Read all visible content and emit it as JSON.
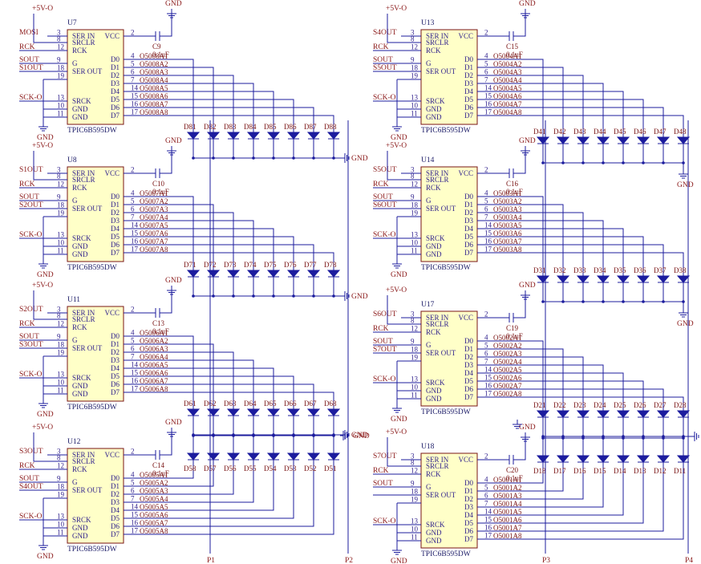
{
  "net_labels": {
    "supply": "+5V-O",
    "ground": "GND",
    "clock": "SCK-O",
    "cap_value": "0.1uF"
  },
  "chip": {
    "part": "TPIC6B595DW",
    "left_pins": [
      "SER IN",
      "SRCLR",
      "RCK",
      "G",
      "SER OUT",
      "",
      "SRCK",
      "GND",
      "GND"
    ],
    "left_nums": [
      "3",
      "8",
      "12",
      "9",
      "18",
      "19",
      "13",
      "10",
      "11"
    ],
    "right_pins": [
      "VCC",
      "D0",
      "D1",
      "D2",
      "D3",
      "D4",
      "D5",
      "D6",
      "D7"
    ],
    "right_nums": [
      "2",
      "4",
      "5",
      "6",
      "7",
      "14",
      "15",
      "16",
      "17"
    ]
  },
  "ports": [
    "P1",
    "P2",
    "P3",
    "P4"
  ],
  "blocks": [
    {
      "id": "U7",
      "cap": "C9",
      "ser_in": "MOSI",
      "sout_a": "SOUT",
      "sout_b": "S1OUT",
      "outputs": [
        "O5008A1",
        "O5008A2",
        "O5008A3",
        "O5008A4",
        "O5008A5",
        "O5008A6",
        "O5008A7",
        "O5008A8"
      ],
      "diodes": [
        "D81",
        "D82",
        "D83",
        "D84",
        "D85",
        "D86",
        "D87",
        "D88"
      ],
      "diodes2": []
    },
    {
      "id": "U8",
      "cap": "C10",
      "ser_in": "S1OUT",
      "sout_a": "SOUT",
      "sout_b": "S2OUT",
      "outputs": [
        "O5007A1",
        "O5007A2",
        "O5007A3",
        "O5007A4",
        "O5007A5",
        "O5007A6",
        "O5007A7",
        "O5007A8"
      ],
      "diodes": [
        "D71",
        "D72",
        "D73",
        "D74",
        "D75",
        "D76",
        "D77",
        "D78"
      ],
      "diodes2": []
    },
    {
      "id": "U11",
      "cap": "C13",
      "ser_in": "S2OUT",
      "sout_a": "SOUT",
      "sout_b": "S3OUT",
      "outputs": [
        "O5006A1",
        "O5006A2",
        "O5006A3",
        "O5006A4",
        "O5006A5",
        "O5006A6",
        "O5006A7",
        "O5006A8"
      ],
      "diodes": [
        "D61",
        "D62",
        "D63",
        "D64",
        "D65",
        "D66",
        "D67",
        "D68"
      ],
      "diodes2": []
    },
    {
      "id": "U12",
      "cap": "C14",
      "ser_in": "S3OUT",
      "sout_a": "SOUT",
      "sout_b": "S4OUT",
      "outputs": [
        "O5005A1",
        "O5005A2",
        "O5005A3",
        "O5005A4",
        "O5005A5",
        "O5005A6",
        "O5005A7",
        "O5005A8"
      ],
      "diodes": [],
      "diodes2": [
        "D58",
        "D57",
        "D56",
        "D55",
        "D54",
        "D53",
        "D52",
        "D51"
      ]
    },
    {
      "id": "U13",
      "cap": "C15",
      "ser_in": "S4OUT",
      "sout_a": "SOUT",
      "sout_b": "S5OUT",
      "outputs": [
        "O5004A1",
        "O5004A2",
        "O5004A3",
        "O5004A4",
        "O5004A5",
        "O5004A6",
        "O5004A7",
        "O5004A8"
      ],
      "diodes": [
        "D41",
        "D42",
        "D43",
        "D44",
        "D45",
        "D46",
        "D47",
        "D48"
      ],
      "diodes2": []
    },
    {
      "id": "U14",
      "cap": "C16",
      "ser_in": "S5OUT",
      "sout_a": "SOUT",
      "sout_b": "S6OUT",
      "outputs": [
        "O5003A1",
        "O5003A2",
        "O5003A3",
        "O5003A4",
        "O5003A5",
        "O5003A6",
        "O5003A7",
        "O5003A8"
      ],
      "diodes": [
        "D31",
        "D32",
        "D33",
        "D34",
        "D35",
        "D36",
        "D37",
        "D38"
      ],
      "diodes2": []
    },
    {
      "id": "U17",
      "cap": "C19",
      "ser_in": "S6OUT",
      "sout_a": "SOUT",
      "sout_b": "S7OUT",
      "outputs": [
        "O5002A1",
        "O5002A2",
        "O5002A3",
        "O5002A4",
        "O5002A5",
        "O5002A6",
        "O5002A7",
        "O5002A8"
      ],
      "diodes": [
        "D21",
        "D22",
        "D23",
        "D24",
        "D25",
        "D26",
        "D27",
        "D28"
      ],
      "diodes2": []
    },
    {
      "id": "U18",
      "cap": "C20",
      "ser_in": "S7OUT",
      "sout_a": "SOUT",
      "sout_b": "",
      "outputs": [
        "O5001A1",
        "O5001A2",
        "O5001A3",
        "O5001A4",
        "O5001A5",
        "O5001A6",
        "O5001A7",
        "O5001A8"
      ],
      "diodes": [],
      "diodes2": [
        "D18",
        "D17",
        "D16",
        "D15",
        "D14",
        "D13",
        "D12",
        "D11"
      ]
    }
  ]
}
